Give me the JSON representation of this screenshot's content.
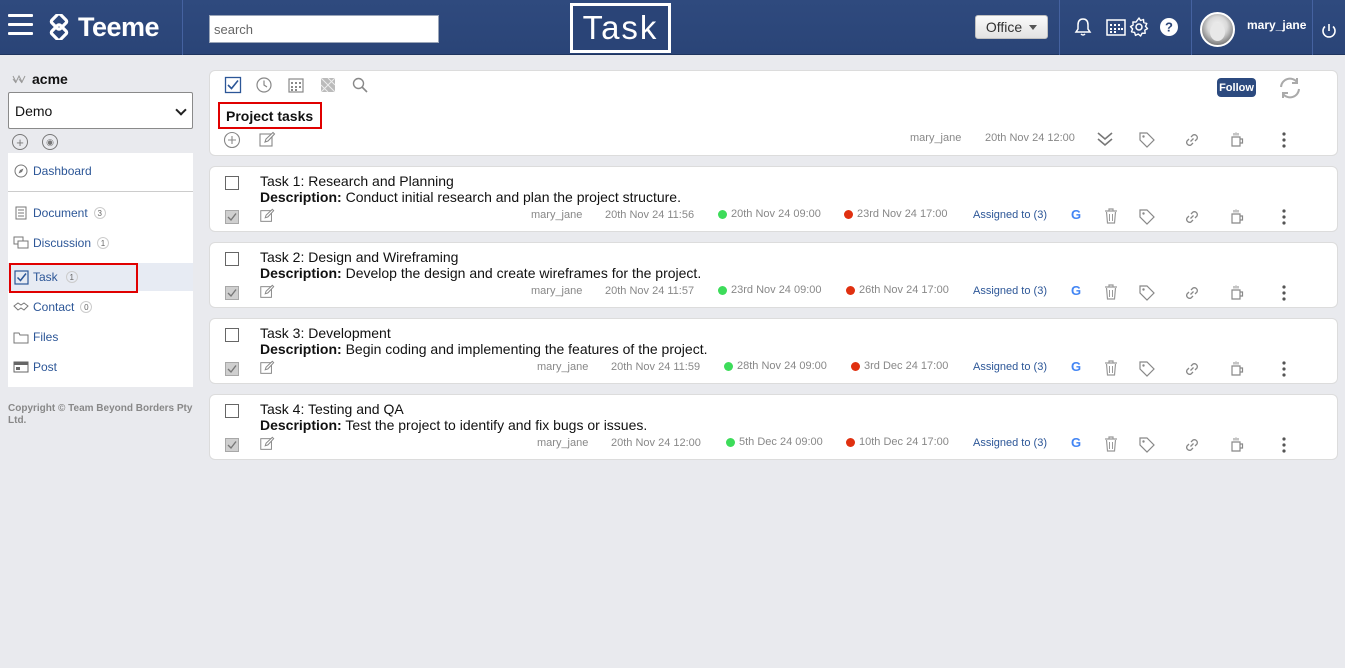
{
  "topbar": {
    "brand": "Teeme",
    "search_placeholder": "search",
    "module_title": "Task",
    "office_label": "Office",
    "username": "mary_jane"
  },
  "sidebar": {
    "org_name": "acme",
    "workspace": "Demo",
    "items": [
      {
        "label": "Dashboard",
        "icon": "compass-icon"
      },
      {
        "label": "Document",
        "badge": "3",
        "icon": "document-icon"
      },
      {
        "label": "Discussion",
        "badge": "1",
        "icon": "discussion-icon"
      },
      {
        "label": "Task",
        "badge": "1",
        "icon": "task-check-icon"
      },
      {
        "label": "Contact",
        "badge": "0",
        "icon": "handshake-icon"
      },
      {
        "label": "Files",
        "icon": "folder-icon"
      },
      {
        "label": "Post",
        "icon": "post-icon"
      }
    ],
    "copyright": "Copyright © Team Beyond Borders Pty Ltd."
  },
  "header": {
    "project_title": "Project tasks",
    "follow_label": "Follow",
    "author": "mary_jane",
    "created": "20th Nov 24 12:00"
  },
  "tasks": [
    {
      "title": "Task 1: Research and Planning",
      "desc_label": "Description:",
      "description": " Conduct initial research and plan the project structure.",
      "author": "mary_jane",
      "created": "20th Nov 24 11:56",
      "start": "20th Nov 24 09:00",
      "end": "23rd Nov 24 17:00",
      "assigned": "Assigned to (3)"
    },
    {
      "title": "Task 2: Design and Wireframing",
      "desc_label": "Description:",
      "description": " Develop the design and create wireframes for the project.",
      "author": "mary_jane",
      "created": "20th Nov 24 11:57",
      "start": "23rd Nov 24 09:00",
      "end": "26th Nov 24 17:00",
      "assigned": "Assigned to (3)"
    },
    {
      "title": "Task 3: Development",
      "desc_label": "Description:",
      "description": " Begin coding and implementing the features of the project.",
      "author": "mary_jane",
      "created": "20th Nov 24 11:59",
      "start": "28th Nov 24 09:00",
      "end": "3rd Dec 24 17:00",
      "assigned": "Assigned to (3)"
    },
    {
      "title": "Task 4: Testing and QA",
      "desc_label": "Description:",
      "description": " Test the project to identify and fix bugs or issues.",
      "author": "mary_jane",
      "created": "20th Nov 24 12:00",
      "start": "5th Dec 24 09:00",
      "end": "10th Dec 24 17:00",
      "assigned": "Assigned to (3)"
    }
  ],
  "colors": {
    "topbar": "#2a4477",
    "link": "#2c5697",
    "start_dot": "#3ddc5a",
    "end_dot": "#e03010",
    "highlight": "#e00000"
  }
}
